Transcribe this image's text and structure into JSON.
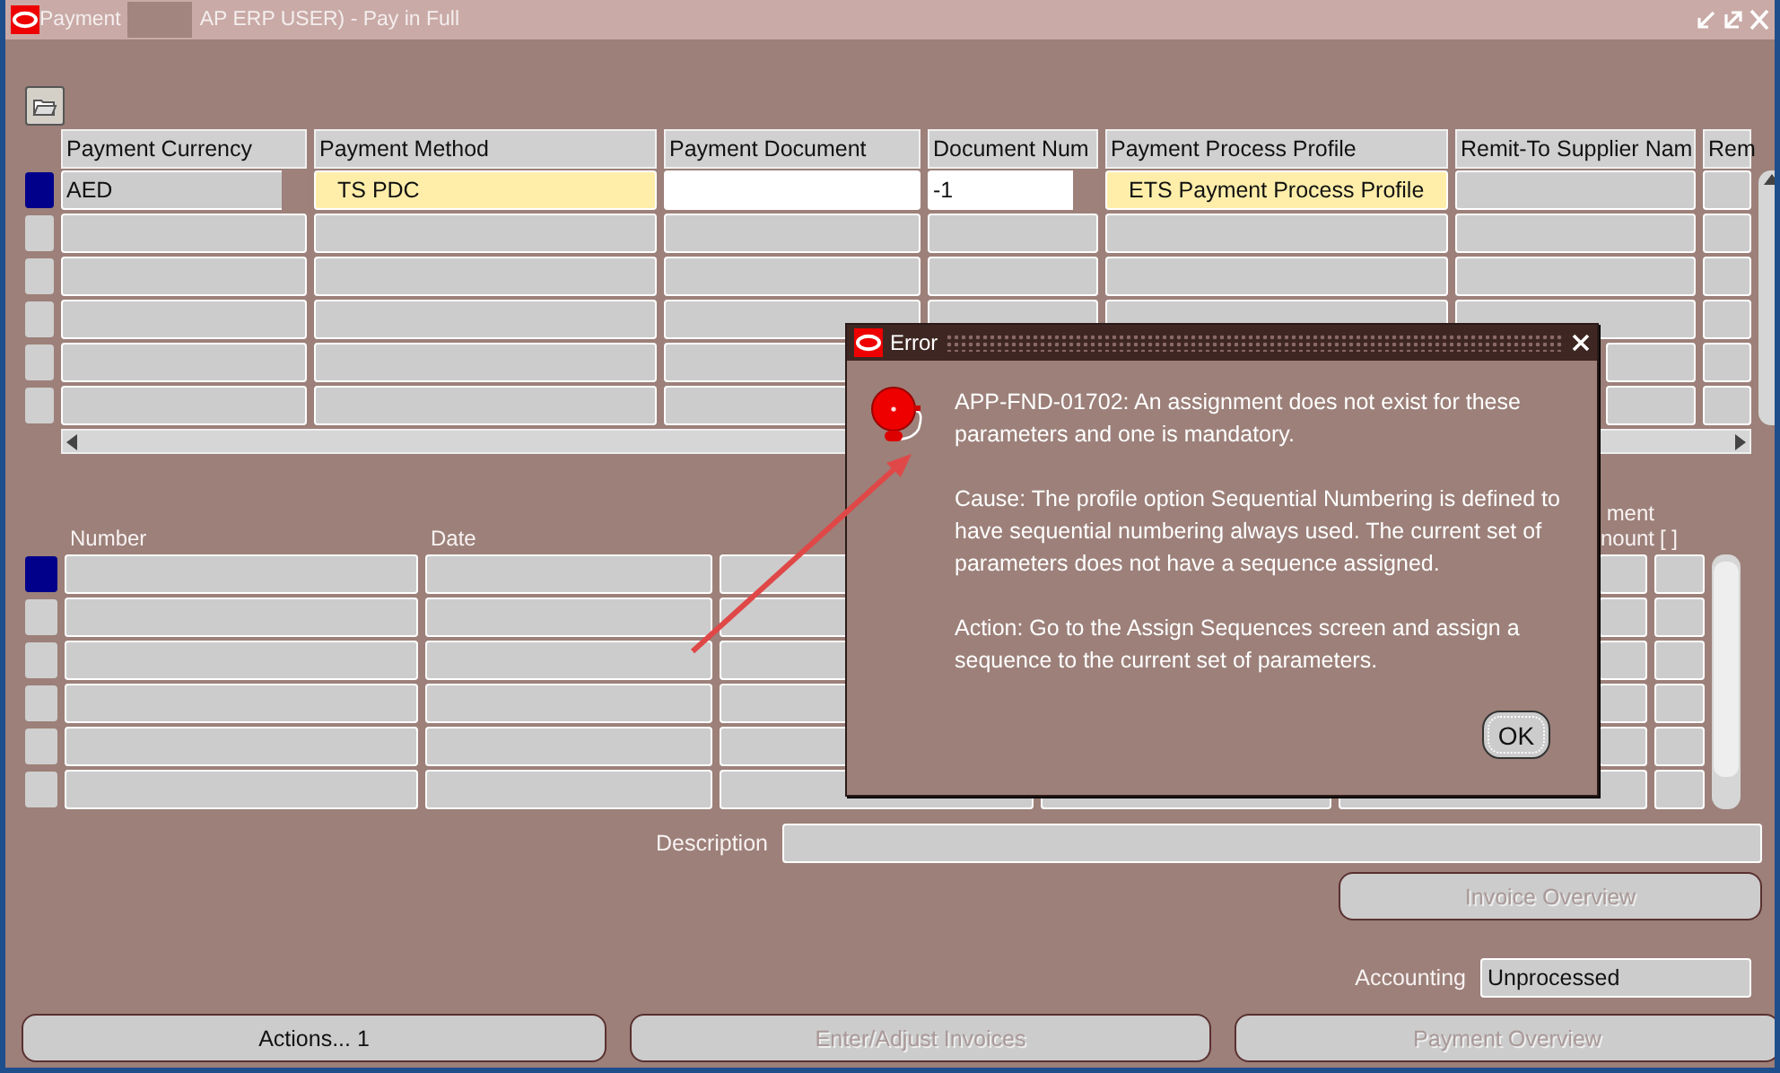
{
  "window": {
    "title_start": "Payment",
    "title_end": "AP ERP USER) - Pay in Full"
  },
  "top_table": {
    "columns": [
      "Payment Currency",
      "Payment Method",
      "Payment Document",
      "Document Num",
      "Payment Process Profile",
      "Remit-To Supplier Nam",
      "Rem"
    ],
    "rows": [
      {
        "selected": true,
        "cells": [
          {
            "kind": "plain",
            "text": "AED",
            "redacted": true
          },
          {
            "kind": "required",
            "text": "TS PDC"
          },
          {
            "kind": "editable"
          },
          {
            "kind": "editable",
            "text": "-1",
            "redacted": true
          },
          {
            "kind": "required",
            "text": "ETS Payment Process Profile"
          },
          {
            "kind": "plain"
          },
          {
            "kind": "plain"
          }
        ]
      },
      {
        "selected": false
      },
      {
        "selected": false
      },
      {
        "selected": false
      },
      {
        "selected": false
      },
      {
        "selected": false
      }
    ]
  },
  "lower_table": {
    "columns": [
      {
        "kind": "text",
        "label": "Number"
      },
      {
        "kind": "text",
        "label": "Date"
      },
      {
        "kind": "blank"
      },
      {
        "kind": "blank"
      },
      {
        "kind": "stacked",
        "lines": [
          "ment",
          "nount"
        ]
      },
      {
        "kind": "text",
        "label": "[ ]"
      }
    ],
    "rows": [
      {
        "selected": true
      },
      {
        "selected": false
      },
      {
        "selected": false
      },
      {
        "selected": false
      },
      {
        "selected": false
      },
      {
        "selected": false
      }
    ]
  },
  "description": {
    "label": "Description"
  },
  "invoice_button": {
    "label": "Invoice Overview",
    "disabled": true
  },
  "accounting": {
    "label": "Accounting",
    "value": "Unprocessed"
  },
  "buttons": [
    {
      "label": "Actions... 1",
      "disabled": false
    },
    {
      "label": "Enter/Adjust Invoices",
      "disabled": true
    },
    {
      "label": "Payment Overview",
      "disabled": true
    }
  ],
  "dialog": {
    "title": "Error",
    "paragraphs": [
      "APP-FND-01702: An assignment does not exist for these parameters and one is mandatory.",
      "Cause: The profile option Sequential Numbering is defined to have sequential numbering always used. The current set of parameters does not have a sequence assigned.",
      "Action: Go to the Assign Sequences screen and assign a sequence to the current set of parameters."
    ],
    "ok": "OK"
  }
}
